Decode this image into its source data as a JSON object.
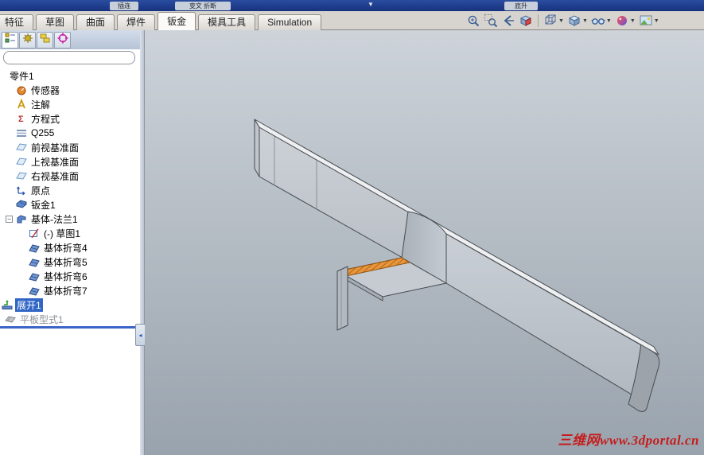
{
  "chrome": {
    "top_strip": {
      "chips": [
        "插连",
        "变文 折断",
        "底升"
      ],
      "caret": "▼"
    },
    "tabs": [
      {
        "label": "特征",
        "active": false
      },
      {
        "label": "草图",
        "active": false
      },
      {
        "label": "曲面",
        "active": false
      },
      {
        "label": "焊件",
        "active": false
      },
      {
        "label": "钣金",
        "active": true
      },
      {
        "label": "模具工具",
        "active": false
      },
      {
        "label": "Simulation",
        "active": false
      }
    ],
    "view_toolbar": [
      {
        "name": "zoom-to-fit-icon",
        "dropdown": false,
        "sep_before": false
      },
      {
        "name": "zoom-to-area-icon",
        "dropdown": false,
        "sep_before": false
      },
      {
        "name": "previous-view-icon",
        "dropdown": false,
        "sep_before": false
      },
      {
        "name": "section-view-icon",
        "dropdown": false,
        "sep_before": false
      },
      {
        "name": "view-orientation-icon",
        "dropdown": true,
        "sep_before": true
      },
      {
        "name": "display-style-icon",
        "dropdown": true,
        "sep_before": false
      },
      {
        "name": "hide-show-items-icon",
        "dropdown": true,
        "sep_before": false
      },
      {
        "name": "edit-appearance-icon",
        "dropdown": true,
        "sep_before": false
      },
      {
        "name": "apply-scene-icon",
        "dropdown": true,
        "sep_before": false
      }
    ]
  },
  "panel": {
    "tabs": [
      {
        "name": "featuremanager-tab-icon",
        "active": true
      },
      {
        "name": "propertymanager-tab-icon",
        "active": false
      },
      {
        "name": "configurationmanager-tab-icon",
        "active": false
      },
      {
        "name": "dimxpert-tab-icon",
        "active": false
      }
    ],
    "tree": {
      "items": [
        {
          "label": "零件1",
          "icon": "",
          "indent": 10,
          "selected": false,
          "grayed": false,
          "expander": false
        },
        {
          "label": "传感器",
          "icon": "sensors-icon",
          "indent": 20,
          "selected": false,
          "grayed": false,
          "expander": false
        },
        {
          "label": "注解",
          "icon": "annotations-icon",
          "indent": 20,
          "selected": false,
          "grayed": false,
          "expander": false
        },
        {
          "label": "方程式",
          "icon": "equations-icon",
          "indent": 20,
          "selected": false,
          "grayed": false,
          "expander": false
        },
        {
          "label": "Q255",
          "icon": "material-icon",
          "indent": 20,
          "selected": false,
          "grayed": false,
          "expander": false
        },
        {
          "label": "前视基准面",
          "icon": "plane-icon",
          "indent": 20,
          "selected": false,
          "grayed": false,
          "expander": false
        },
        {
          "label": "上视基准面",
          "icon": "plane-icon",
          "indent": 20,
          "selected": false,
          "grayed": false,
          "expander": false
        },
        {
          "label": "右视基准面",
          "icon": "plane-icon",
          "indent": 20,
          "selected": false,
          "grayed": false,
          "expander": false
        },
        {
          "label": "原点",
          "icon": "origin-icon",
          "indent": 20,
          "selected": false,
          "grayed": false,
          "expander": false
        },
        {
          "label": "钣金1",
          "icon": "sheet-metal-icon",
          "indent": 20,
          "selected": false,
          "grayed": false,
          "expander": false
        },
        {
          "label": "基体-法兰1",
          "icon": "base-flange-icon",
          "indent": 20,
          "selected": false,
          "grayed": false,
          "expander": true
        },
        {
          "label": "(-) 草图1",
          "icon": "sketch-icon",
          "indent": 36,
          "selected": false,
          "grayed": false,
          "expander": false
        },
        {
          "label": "基体折弯4",
          "icon": "bend-icon",
          "indent": 36,
          "selected": false,
          "grayed": false,
          "expander": false
        },
        {
          "label": "基体折弯5",
          "icon": "bend-icon",
          "indent": 36,
          "selected": false,
          "grayed": false,
          "expander": false
        },
        {
          "label": "基体折弯6",
          "icon": "bend-icon",
          "indent": 36,
          "selected": false,
          "grayed": false,
          "expander": false
        },
        {
          "label": "基体折弯7",
          "icon": "bend-icon",
          "indent": 36,
          "selected": false,
          "grayed": false,
          "expander": false
        },
        {
          "label": "展开1",
          "icon": "unfold-icon",
          "indent": 2,
          "selected": true,
          "grayed": false,
          "expander": false
        },
        {
          "label": "平板型式1",
          "icon": "flat-pattern-icon",
          "indent": 6,
          "selected": false,
          "grayed": true,
          "expander": false
        }
      ]
    }
  },
  "viewport": {
    "watermark": "三维网www.3dportal.cn",
    "background_top": "#cdd3d9",
    "background_bottom": "#99a3ad",
    "selection_color": "#3166c6",
    "bend_highlight_color": "#e8953c",
    "part_name": "sheet-metal-part"
  }
}
